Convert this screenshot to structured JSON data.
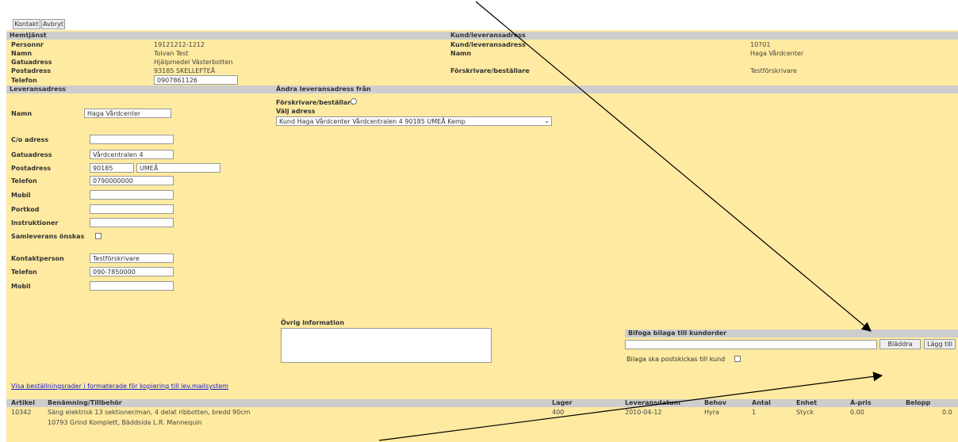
{
  "toolbar": {
    "back_label": "Kontakt",
    "cancel_label": "Avbryt"
  },
  "customer": {
    "header": "Hemtjänst",
    "rows": [
      {
        "label": "Personnr",
        "value": "19121212-1212"
      },
      {
        "label": "Namn",
        "value": "Tolvan Test"
      },
      {
        "label": "Gatuadress",
        "value": "Hjälpmedel Västerbotten"
      },
      {
        "label": "Postadress",
        "value": "93185 SKELLEFTEÅ"
      },
      {
        "label": "Telefon",
        "value": "0907861126"
      }
    ]
  },
  "supplier": {
    "header": "Kund/leveransadress",
    "rows": [
      {
        "label": "Kund/leveransadress",
        "value": "10701"
      },
      {
        "label": "Namn",
        "value": "Haga Vårdcenter"
      },
      {
        "label": "Förskrivare/beställare",
        "value": "Testförskrivare"
      }
    ]
  },
  "delivery": {
    "header": "Leveransadress",
    "name_label": "Namn",
    "name_value": "Haga Vårdcenter",
    "co_label": "C/o adress",
    "co_value": "",
    "street_label": "Gatuadress",
    "street_value": "Vårdcentralen 4",
    "postal_label": "Postadress",
    "postal_zip": "90185",
    "postal_city": "UMEÅ",
    "phone_label": "Telefon",
    "phone_value": "0790000000",
    "mobile_label": "Mobil",
    "mobile_value": "",
    "fax_label": "Portkod",
    "fax_value": "",
    "instructions_label": "Instruktioner",
    "instructions_value": "",
    "collect_label": "Samleverans önskas",
    "contact_label": "Kontaktperson",
    "contact_value": "Testförskrivare",
    "contact_phone_label": "Telefon",
    "contact_phone_value": "090-7850000",
    "contact_mobile_label": "Mobil",
    "contact_mobile_value": ""
  },
  "other_delivery": {
    "header": "Ändra leveransadress från",
    "prescriber_label": "Förskrivare/beställare",
    "choose_label": "Välj adress",
    "select_value": "Kund Haga Vårdcenter Vårdcentralen 4 90185 UMEÅ Kemp"
  },
  "other_info": {
    "label": "Övrig information",
    "value": ""
  },
  "attachment": {
    "header": "Bifoga bilaga till kundorder",
    "browse_label": "Bläddra",
    "add_label": "Lägg till",
    "paper_label": "Bilaga ska postskickas till kund"
  },
  "link_text": "Visa beställningsrader i formaterade för kopiering till lev.mailsystem",
  "table": {
    "headers": [
      "Artikel",
      "Benämning/Tillbehör",
      "Lager",
      "Leveransdatum",
      "Behov",
      "Antal",
      "Enhet",
      "Á-pris",
      "Belopp"
    ],
    "row": {
      "article": "10342",
      "description": "Säng elektrisk 13 sektioner/man, 4 delat ribbotten, bredd 90cm",
      "stock": "400",
      "date": "2010-04-12",
      "need": "Hyra",
      "qty": "1",
      "unit": "Styck",
      "price": "0.00",
      "amount": "0.0"
    },
    "subrow": "10793 Grind Komplett, Bäddsida L.R. Mannequin"
  }
}
